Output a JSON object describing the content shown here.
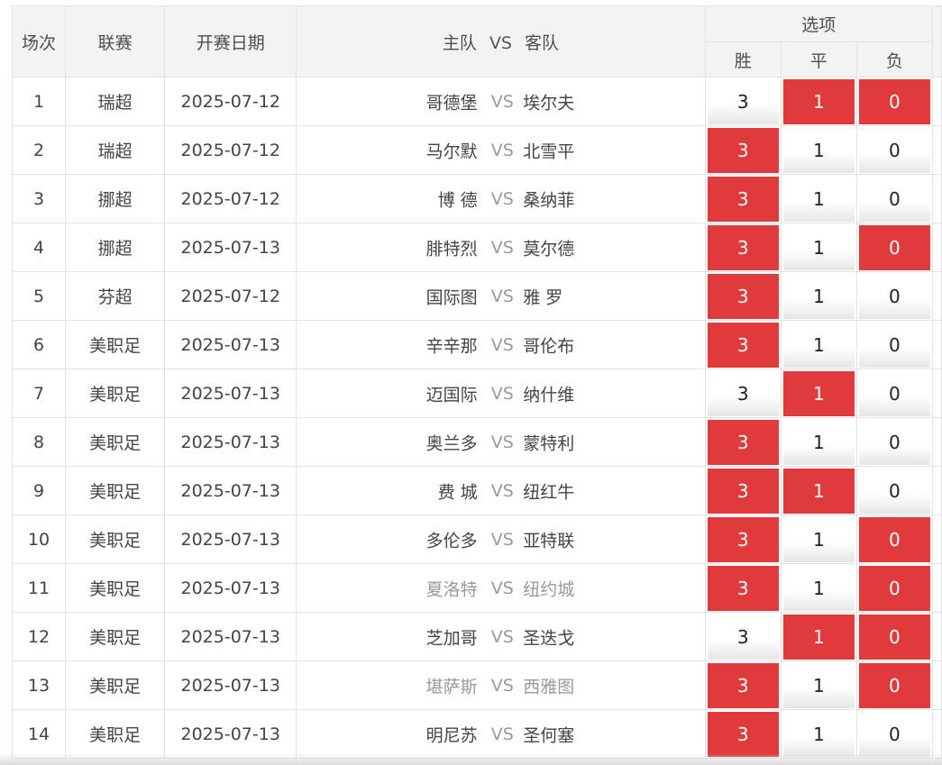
{
  "header": {
    "no": "场次",
    "league": "联赛",
    "date": "开赛日期",
    "home": "主队",
    "vs": "VS",
    "away": "客队",
    "options": "选项",
    "win": "胜",
    "draw": "平",
    "loss": "负"
  },
  "colors": {
    "selected": "#e03a3c",
    "vs_text": "#9a9a9a"
  },
  "matches": [
    {
      "no": "1",
      "league": "瑞超",
      "date": "2025-07-12",
      "home": "哥德堡",
      "away": "埃尔夫",
      "win": "3",
      "draw": "1",
      "loss": "0",
      "sel": [
        "draw",
        "loss"
      ],
      "dim": false
    },
    {
      "no": "2",
      "league": "瑞超",
      "date": "2025-07-12",
      "home": "马尔默",
      "away": "北雪平",
      "win": "3",
      "draw": "1",
      "loss": "0",
      "sel": [
        "win"
      ],
      "dim": false
    },
    {
      "no": "3",
      "league": "挪超",
      "date": "2025-07-12",
      "home": "博 德",
      "away": "桑纳菲",
      "win": "3",
      "draw": "1",
      "loss": "0",
      "sel": [
        "win"
      ],
      "dim": false
    },
    {
      "no": "4",
      "league": "挪超",
      "date": "2025-07-13",
      "home": "腓特烈",
      "away": "莫尔德",
      "win": "3",
      "draw": "1",
      "loss": "0",
      "sel": [
        "win",
        "loss"
      ],
      "dim": false
    },
    {
      "no": "5",
      "league": "芬超",
      "date": "2025-07-12",
      "home": "国际图",
      "away": "雅 罗",
      "win": "3",
      "draw": "1",
      "loss": "0",
      "sel": [
        "win"
      ],
      "dim": false
    },
    {
      "no": "6",
      "league": "美职足",
      "date": "2025-07-13",
      "home": "辛辛那",
      "away": "哥伦布",
      "win": "3",
      "draw": "1",
      "loss": "0",
      "sel": [
        "win"
      ],
      "dim": false
    },
    {
      "no": "7",
      "league": "美职足",
      "date": "2025-07-13",
      "home": "迈国际",
      "away": "纳什维",
      "win": "3",
      "draw": "1",
      "loss": "0",
      "sel": [
        "draw"
      ],
      "dim": false
    },
    {
      "no": "8",
      "league": "美职足",
      "date": "2025-07-13",
      "home": "奥兰多",
      "away": "蒙特利",
      "win": "3",
      "draw": "1",
      "loss": "0",
      "sel": [
        "win"
      ],
      "dim": false
    },
    {
      "no": "9",
      "league": "美职足",
      "date": "2025-07-13",
      "home": "费 城",
      "away": "纽红牛",
      "win": "3",
      "draw": "1",
      "loss": "0",
      "sel": [
        "win",
        "draw"
      ],
      "dim": false
    },
    {
      "no": "10",
      "league": "美职足",
      "date": "2025-07-13",
      "home": "多伦多",
      "away": "亚特联",
      "win": "3",
      "draw": "1",
      "loss": "0",
      "sel": [
        "win",
        "loss"
      ],
      "dim": false
    },
    {
      "no": "11",
      "league": "美职足",
      "date": "2025-07-13",
      "home": "夏洛特",
      "away": "纽约城",
      "win": "3",
      "draw": "1",
      "loss": "0",
      "sel": [
        "win",
        "loss"
      ],
      "dim": true
    },
    {
      "no": "12",
      "league": "美职足",
      "date": "2025-07-13",
      "home": "芝加哥",
      "away": "圣迭戈",
      "win": "3",
      "draw": "1",
      "loss": "0",
      "sel": [
        "draw",
        "loss"
      ],
      "dim": false
    },
    {
      "no": "13",
      "league": "美职足",
      "date": "2025-07-13",
      "home": "堪萨斯",
      "away": "西雅图",
      "win": "3",
      "draw": "1",
      "loss": "0",
      "sel": [
        "win",
        "loss"
      ],
      "dim": true
    },
    {
      "no": "14",
      "league": "美职足",
      "date": "2025-07-13",
      "home": "明尼苏",
      "away": "圣何塞",
      "win": "3",
      "draw": "1",
      "loss": "0",
      "sel": [
        "win"
      ],
      "dim": false
    }
  ]
}
